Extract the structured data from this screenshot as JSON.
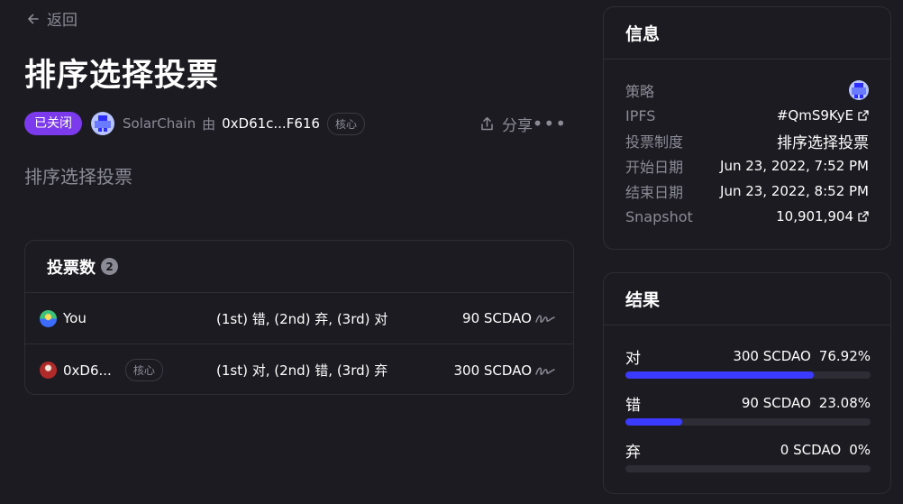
{
  "nav": {
    "back_label": "返回"
  },
  "proposal": {
    "title": "排序选择投票",
    "state": "已关闭",
    "space_name": "SolarChain",
    "by_label": "由",
    "author": "0xD61c...F616",
    "author_badge": "核心",
    "share_label": "分享",
    "more_label": "•••",
    "body": "排序选择投票"
  },
  "votes": {
    "title": "投票数",
    "count": "2",
    "rows": [
      {
        "voter": "You",
        "badge": "",
        "choice": "(1st) 错, (2nd) 弃, (3rd) 对",
        "power": "90 SCDAO"
      },
      {
        "voter": "0xD6...",
        "badge": "核心",
        "choice": "(1st) 对, (2nd) 错, (3rd) 弃",
        "power": "300 SCDAO"
      }
    ]
  },
  "info": {
    "title": "信息",
    "strategy_label": "策略",
    "ipfs_label": "IPFS",
    "ipfs_value": "#QmS9KyE",
    "voting_system_label": "投票制度",
    "voting_system_value": "排序选择投票",
    "start_label": "开始日期",
    "start_value": "Jun 23, 2022, 7:52 PM",
    "end_label": "结束日期",
    "end_value": "Jun 23, 2022, 8:52 PM",
    "snapshot_label": "Snapshot",
    "snapshot_value": "10,901,904"
  },
  "results": {
    "title": "结果",
    "items": [
      {
        "choice": "对",
        "power": "300 SCDAO",
        "percent": "76.92%",
        "fraction": 0.7692
      },
      {
        "choice": "错",
        "power": "90 SCDAO",
        "percent": "23.08%",
        "fraction": 0.2308
      },
      {
        "choice": "弃",
        "power": "0 SCDAO",
        "percent": "0%",
        "fraction": 0
      }
    ]
  },
  "colors": {
    "background": "#1c1b22",
    "state_badge": "#7c3aed",
    "result_bar": "#3b3bff",
    "muted_text": "#8b8b96",
    "border": "#2e2d36"
  },
  "icons": {
    "back": "arrow-left-icon",
    "share": "share-icon",
    "more": "ellipsis-icon",
    "external": "external-link-icon",
    "signature": "signature-icon"
  }
}
